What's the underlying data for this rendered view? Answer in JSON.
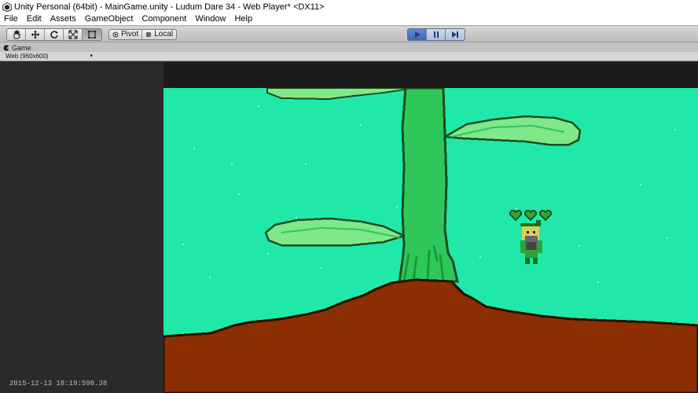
{
  "window": {
    "title": "Unity Personal (64bit) - MainGame.unity - Ludum Dare 34 - Web Player* <DX11>"
  },
  "menu": {
    "items": [
      "File",
      "Edit",
      "Assets",
      "GameObject",
      "Component",
      "Window",
      "Help"
    ]
  },
  "toolbar": {
    "tools": [
      "hand-icon",
      "move-icon",
      "rotate-icon",
      "scale-icon",
      "rect-icon"
    ],
    "pivot_label": "Pivot",
    "local_label": "Local",
    "play_controls": [
      "play-icon",
      "pause-icon",
      "step-icon"
    ]
  },
  "game_tab": {
    "label": "Game",
    "resolution": "Web (960x600)"
  },
  "game": {
    "hearts": 3,
    "colors": {
      "sky": "#1fe8a8",
      "ground": "#8b2e02",
      "trunk": "#2fc75a",
      "leaf": "#7fe88a",
      "outline": "#184e1e"
    }
  },
  "status": {
    "timestamp": "2015-12-13 18:19:598.38"
  }
}
